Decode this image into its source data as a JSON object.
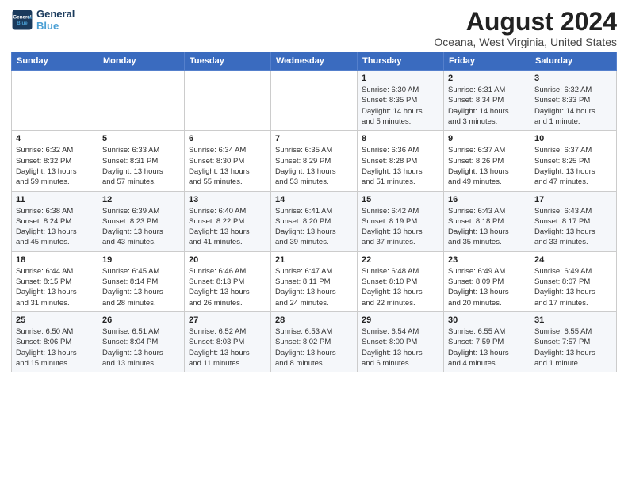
{
  "header": {
    "logo_line1": "General",
    "logo_line2": "Blue",
    "month_year": "August 2024",
    "location": "Oceana, West Virginia, United States"
  },
  "weekdays": [
    "Sunday",
    "Monday",
    "Tuesday",
    "Wednesday",
    "Thursday",
    "Friday",
    "Saturday"
  ],
  "weeks": [
    [
      {
        "day": "",
        "info": ""
      },
      {
        "day": "",
        "info": ""
      },
      {
        "day": "",
        "info": ""
      },
      {
        "day": "",
        "info": ""
      },
      {
        "day": "1",
        "info": "Sunrise: 6:30 AM\nSunset: 8:35 PM\nDaylight: 14 hours\nand 5 minutes."
      },
      {
        "day": "2",
        "info": "Sunrise: 6:31 AM\nSunset: 8:34 PM\nDaylight: 14 hours\nand 3 minutes."
      },
      {
        "day": "3",
        "info": "Sunrise: 6:32 AM\nSunset: 8:33 PM\nDaylight: 14 hours\nand 1 minute."
      }
    ],
    [
      {
        "day": "4",
        "info": "Sunrise: 6:32 AM\nSunset: 8:32 PM\nDaylight: 13 hours\nand 59 minutes."
      },
      {
        "day": "5",
        "info": "Sunrise: 6:33 AM\nSunset: 8:31 PM\nDaylight: 13 hours\nand 57 minutes."
      },
      {
        "day": "6",
        "info": "Sunrise: 6:34 AM\nSunset: 8:30 PM\nDaylight: 13 hours\nand 55 minutes."
      },
      {
        "day": "7",
        "info": "Sunrise: 6:35 AM\nSunset: 8:29 PM\nDaylight: 13 hours\nand 53 minutes."
      },
      {
        "day": "8",
        "info": "Sunrise: 6:36 AM\nSunset: 8:28 PM\nDaylight: 13 hours\nand 51 minutes."
      },
      {
        "day": "9",
        "info": "Sunrise: 6:37 AM\nSunset: 8:26 PM\nDaylight: 13 hours\nand 49 minutes."
      },
      {
        "day": "10",
        "info": "Sunrise: 6:37 AM\nSunset: 8:25 PM\nDaylight: 13 hours\nand 47 minutes."
      }
    ],
    [
      {
        "day": "11",
        "info": "Sunrise: 6:38 AM\nSunset: 8:24 PM\nDaylight: 13 hours\nand 45 minutes."
      },
      {
        "day": "12",
        "info": "Sunrise: 6:39 AM\nSunset: 8:23 PM\nDaylight: 13 hours\nand 43 minutes."
      },
      {
        "day": "13",
        "info": "Sunrise: 6:40 AM\nSunset: 8:22 PM\nDaylight: 13 hours\nand 41 minutes."
      },
      {
        "day": "14",
        "info": "Sunrise: 6:41 AM\nSunset: 8:20 PM\nDaylight: 13 hours\nand 39 minutes."
      },
      {
        "day": "15",
        "info": "Sunrise: 6:42 AM\nSunset: 8:19 PM\nDaylight: 13 hours\nand 37 minutes."
      },
      {
        "day": "16",
        "info": "Sunrise: 6:43 AM\nSunset: 8:18 PM\nDaylight: 13 hours\nand 35 minutes."
      },
      {
        "day": "17",
        "info": "Sunrise: 6:43 AM\nSunset: 8:17 PM\nDaylight: 13 hours\nand 33 minutes."
      }
    ],
    [
      {
        "day": "18",
        "info": "Sunrise: 6:44 AM\nSunset: 8:15 PM\nDaylight: 13 hours\nand 31 minutes."
      },
      {
        "day": "19",
        "info": "Sunrise: 6:45 AM\nSunset: 8:14 PM\nDaylight: 13 hours\nand 28 minutes."
      },
      {
        "day": "20",
        "info": "Sunrise: 6:46 AM\nSunset: 8:13 PM\nDaylight: 13 hours\nand 26 minutes."
      },
      {
        "day": "21",
        "info": "Sunrise: 6:47 AM\nSunset: 8:11 PM\nDaylight: 13 hours\nand 24 minutes."
      },
      {
        "day": "22",
        "info": "Sunrise: 6:48 AM\nSunset: 8:10 PM\nDaylight: 13 hours\nand 22 minutes."
      },
      {
        "day": "23",
        "info": "Sunrise: 6:49 AM\nSunset: 8:09 PM\nDaylight: 13 hours\nand 20 minutes."
      },
      {
        "day": "24",
        "info": "Sunrise: 6:49 AM\nSunset: 8:07 PM\nDaylight: 13 hours\nand 17 minutes."
      }
    ],
    [
      {
        "day": "25",
        "info": "Sunrise: 6:50 AM\nSunset: 8:06 PM\nDaylight: 13 hours\nand 15 minutes."
      },
      {
        "day": "26",
        "info": "Sunrise: 6:51 AM\nSunset: 8:04 PM\nDaylight: 13 hours\nand 13 minutes."
      },
      {
        "day": "27",
        "info": "Sunrise: 6:52 AM\nSunset: 8:03 PM\nDaylight: 13 hours\nand 11 minutes."
      },
      {
        "day": "28",
        "info": "Sunrise: 6:53 AM\nSunset: 8:02 PM\nDaylight: 13 hours\nand 8 minutes."
      },
      {
        "day": "29",
        "info": "Sunrise: 6:54 AM\nSunset: 8:00 PM\nDaylight: 13 hours\nand 6 minutes."
      },
      {
        "day": "30",
        "info": "Sunrise: 6:55 AM\nSunset: 7:59 PM\nDaylight: 13 hours\nand 4 minutes."
      },
      {
        "day": "31",
        "info": "Sunrise: 6:55 AM\nSunset: 7:57 PM\nDaylight: 13 hours\nand 1 minute."
      }
    ]
  ]
}
